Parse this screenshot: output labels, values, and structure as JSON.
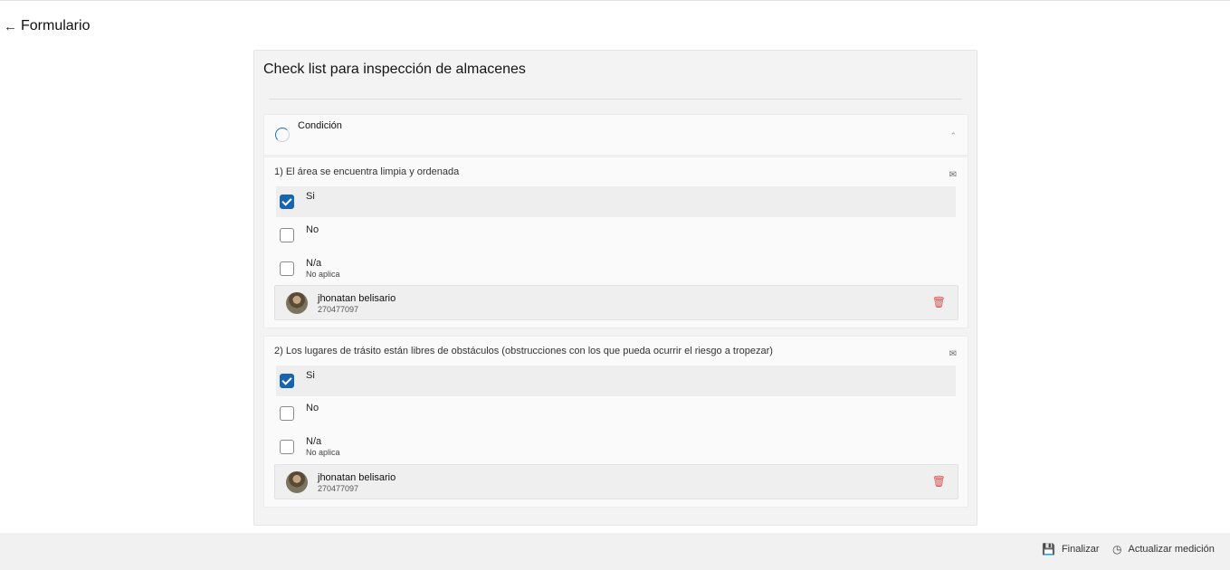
{
  "header": {
    "back_icon": "arrow-left-icon",
    "title": "Formulario"
  },
  "card": {
    "title": "Check list para inspección de almacenes"
  },
  "section": {
    "label": "Condición",
    "spinner_icon": "progress-spinner-icon",
    "chevron_icon": "chevron-up-icon"
  },
  "questions": [
    {
      "text": "1) El área se encuentra limpia y ordenada",
      "icon": "image-icon",
      "options": [
        {
          "label": "Si",
          "sub": "",
          "checked": true
        },
        {
          "label": "No",
          "sub": "",
          "checked": false
        },
        {
          "label": "N/a",
          "sub": "No aplica",
          "checked": false
        }
      ],
      "user": {
        "name": "jhonatan belisario",
        "id": "270477097"
      }
    },
    {
      "text": "2) Los lugares de trásito están libres de obstáculos (obstrucciones con los que pueda ocurrir el riesgo a tropezar)",
      "icon": "image-icon",
      "options": [
        {
          "label": "Si",
          "sub": "",
          "checked": true
        },
        {
          "label": "No",
          "sub": "",
          "checked": false
        },
        {
          "label": "N/a",
          "sub": "No aplica",
          "checked": false
        }
      ],
      "user": {
        "name": "jhonatan belisario",
        "id": "270477097"
      }
    }
  ],
  "footer": {
    "finalize_label": "Finalizar",
    "update_label": "Actualizar medición"
  },
  "colors": {
    "accent": "#1764b0",
    "danger": "#d9534f",
    "footer_bg": "#f1f1f1"
  }
}
